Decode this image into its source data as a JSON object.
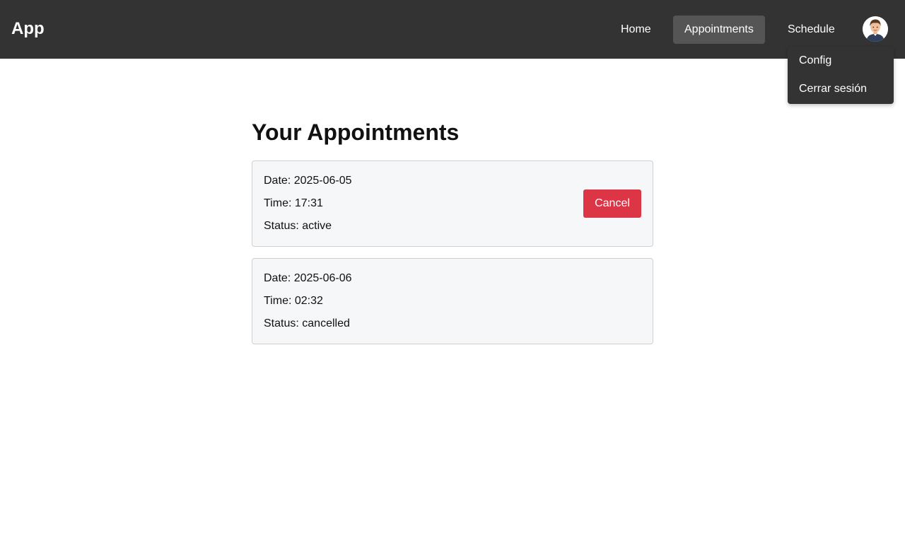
{
  "navbar": {
    "brand": "App",
    "links": [
      {
        "label": "Home"
      },
      {
        "label": "Appointments",
        "active": true
      },
      {
        "label": "Schedule"
      }
    ],
    "avatar_icon": "user-avatar-icon",
    "dropdown": {
      "items": [
        {
          "label": "Config"
        },
        {
          "label": "Cerrar sesión"
        }
      ]
    }
  },
  "main": {
    "title": "Your Appointments",
    "appointments": [
      {
        "date_label": "Date:",
        "date": "2025-06-05",
        "time_label": "Time:",
        "time": "17:31",
        "status_label": "Status:",
        "status": "active",
        "action_label": "Cancel"
      },
      {
        "date_label": "Date:",
        "date": "2025-06-06",
        "time_label": "Time:",
        "time": "02:32",
        "status_label": "Status:",
        "status": "cancelled"
      }
    ]
  },
  "colors": {
    "navbar_bg": "#333333",
    "active_link_bg": "#555555",
    "card_bg": "#f6f7f9",
    "danger": "#dc3545"
  }
}
